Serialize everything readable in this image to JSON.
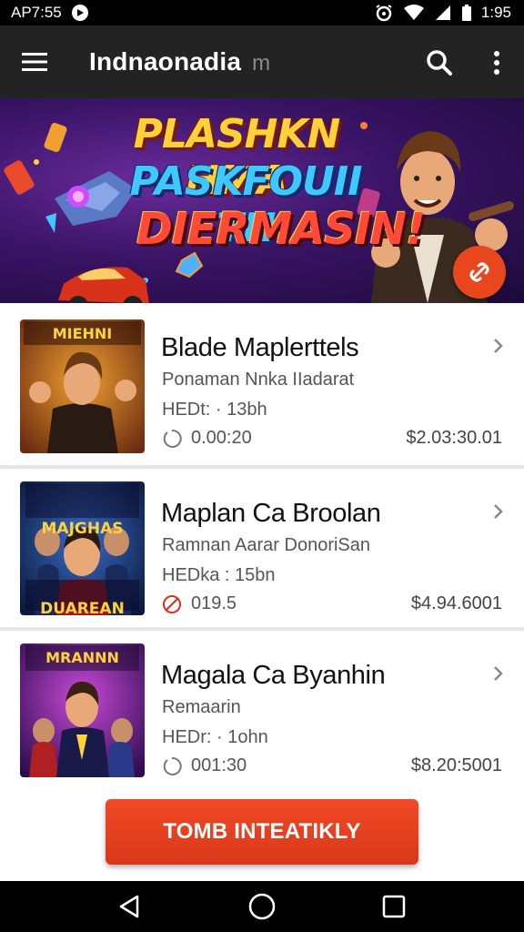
{
  "status_bar": {
    "time_left": "AP7:55",
    "time_right": "1:95"
  },
  "app_bar": {
    "title": "Indnaonadia",
    "title_suffix": "m"
  },
  "banner": {
    "line1": "PLASHKN HMA",
    "line2": "PASKFOUII TH",
    "line3": "DIERMASIN!"
  },
  "items": [
    {
      "title": "Blade Maplerttels",
      "subtitle": "Ponaman Nnka IIadarat",
      "meta": "HEDt: · 13bh",
      "time": "0.00:20",
      "price": "$2.03:30.01",
      "thumb_caption": "MIEHNI"
    },
    {
      "title": "Maplan Ca Broolan",
      "subtitle": "Ramnan Aarar DonoriSan",
      "meta": "HEDka : 15bn",
      "time": "019.5",
      "price": "$4.94.6001",
      "thumb_caption": "MAJGHAS DUAREAN"
    },
    {
      "title": "Magala Ca Byanhin",
      "subtitle": "Remaarin",
      "meta": "HEDr: · 1ohn",
      "time": "001:30",
      "price": "$8.20:5001",
      "thumb_caption": "MRANNN"
    }
  ],
  "cta": {
    "label": "TOMB INTEATIKLY"
  },
  "colors": {
    "app_bar": "#232323",
    "accent": "#e8471d",
    "status_bar": "#000000"
  },
  "icons": {
    "menu": "menu-icon",
    "search": "search-icon",
    "more": "more-vert-icon",
    "fab": "link-icon",
    "chevron": "chevron-right-icon",
    "back": "back-icon",
    "home": "home-icon",
    "recents": "recents-icon"
  }
}
